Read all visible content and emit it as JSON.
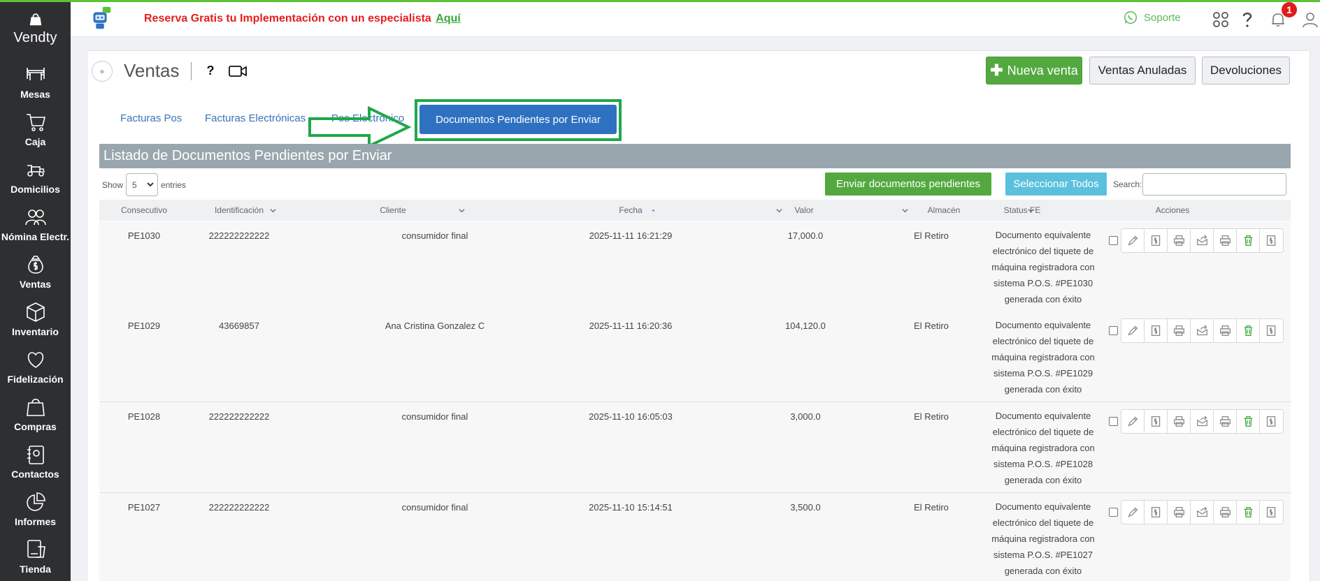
{
  "brand": {
    "name": "Vendty"
  },
  "sidebar": {
    "items": [
      {
        "label": "Mesas",
        "icon": "tables-icon"
      },
      {
        "label": "Caja",
        "icon": "cart-icon"
      },
      {
        "label": "Domicilios",
        "icon": "delivery-icon"
      },
      {
        "label": "Nómina Electr.",
        "icon": "people-icon"
      },
      {
        "label": "Ventas",
        "icon": "money-bag-icon"
      },
      {
        "label": "Inventario",
        "icon": "box-icon"
      },
      {
        "label": "Fidelización",
        "icon": "heart-icon"
      },
      {
        "label": "Compras",
        "icon": "shopping-bag-icon"
      },
      {
        "label": "Contactos",
        "icon": "contacts-icon"
      },
      {
        "label": "Informes",
        "icon": "pie-chart-icon"
      },
      {
        "label": "Tienda",
        "icon": "store-icon"
      }
    ]
  },
  "header": {
    "promo_text": "Reserva Gratis tu Implementación con un especialista",
    "promo_link": "Aquí",
    "support_label": "Soporte",
    "notification_count": "1"
  },
  "page": {
    "title": "Ventas",
    "help": "?",
    "new_sale_label": "Nueva venta",
    "voided_label": "Ventas Anuladas",
    "returns_label": "Devoluciones"
  },
  "tabs": [
    {
      "label": "Facturas Pos"
    },
    {
      "label": "Facturas Electrónicas"
    },
    {
      "label": "Pos Electrónico"
    },
    {
      "label": "Documentos Pendientes por Enviar",
      "active": true
    }
  ],
  "listing": {
    "title": "Listado de Documentos Pendientes por Enviar",
    "show_label": "Show",
    "entries_value": "5",
    "entries_label": "entries",
    "send_pending_label": "Enviar documentos pendientes",
    "select_all_label": "Seleccionar Todos",
    "search_label": "Search:"
  },
  "table": {
    "columns": [
      "Consecutivo",
      "Identificación",
      "Cliente",
      "Fecha",
      "Valor",
      "Almacén",
      "Status FE",
      "Acciones"
    ],
    "rows": [
      {
        "consecutivo": "PE1030",
        "identificacion": "222222222222",
        "cliente": "consumidor final",
        "fecha": "2025-11-11 16:21:29",
        "valor": "17,000.0",
        "almacen": "El Retiro",
        "status": [
          "Documento equivalente",
          "electrónico del tiquete de",
          "máquina registradora con",
          "sistema P.O.S. #PE1030",
          "generada con éxito"
        ]
      },
      {
        "consecutivo": "PE1029",
        "identificacion": "43669857",
        "cliente": "Ana Cristina Gonzalez C",
        "fecha": "2025-11-11 16:20:36",
        "valor": "104,120.0",
        "almacen": "El Retiro",
        "status": [
          "Documento equivalente",
          "electrónico del tiquete de",
          "máquina registradora con",
          "sistema P.O.S. #PE1029",
          "generada con éxito"
        ]
      },
      {
        "consecutivo": "PE1028",
        "identificacion": "222222222222",
        "cliente": "consumidor final",
        "fecha": "2025-11-10 16:05:03",
        "valor": "3,000.0",
        "almacen": "El Retiro",
        "status": [
          "Documento equivalente",
          "electrónico del tiquete de",
          "máquina registradora con",
          "sistema P.O.S. #PE1028",
          "generada con éxito"
        ]
      },
      {
        "consecutivo": "PE1027",
        "identificacion": "222222222222",
        "cliente": "consumidor final",
        "fecha": "2025-11-10 15:14:51",
        "valor": "3,500.0",
        "almacen": "El Retiro",
        "status": [
          "Documento equivalente",
          "electrónico del tiquete de",
          "máquina registradora con",
          "sistema P.O.S. #PE1027",
          "generada con éxito"
        ]
      }
    ]
  },
  "colors": {
    "sidebar_bg": "#2e2f31",
    "accent_green": "#53a93f",
    "tab_blue": "#2f71c1",
    "select_all_cyan": "#5bc0de",
    "promo_red": "#e32020",
    "highlight_green": "#1fa84a"
  }
}
